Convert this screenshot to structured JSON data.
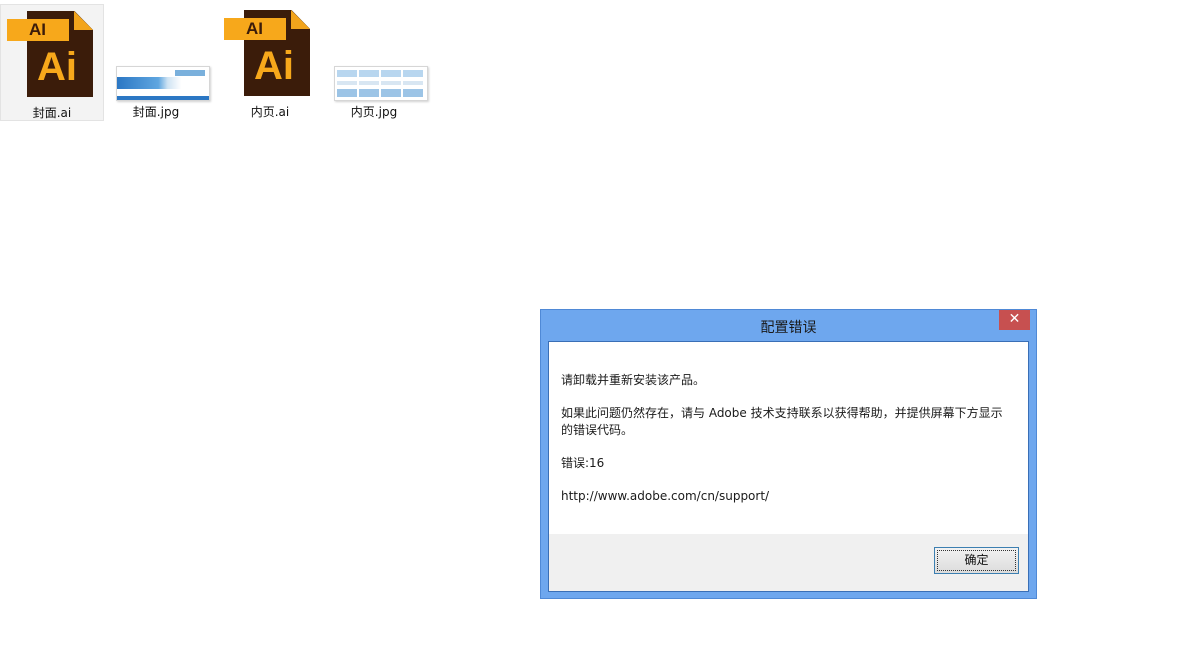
{
  "files": [
    {
      "name": "封面.ai",
      "type": "ai",
      "icon_text": "AI",
      "icon_big": "Ai",
      "selected": true
    },
    {
      "name": "封面.jpg",
      "type": "jpg",
      "selected": false
    },
    {
      "name": "内页.ai",
      "type": "ai",
      "icon_text": "AI",
      "icon_big": "Ai",
      "selected": false
    },
    {
      "name": "内页.jpg",
      "type": "jpg",
      "selected": false
    }
  ],
  "dialog": {
    "title": "配置错误",
    "close_label": "✕",
    "line1": "请卸载并重新安装该产品。",
    "line2": "如果此问题仍然存在，请与 Adobe 技术支持联系以获得帮助，并提供屏幕下方显示的错误代码。",
    "error_code": "错误:16",
    "support_url": "http://www.adobe.com/cn/support/",
    "ok_label": "确定"
  },
  "colors": {
    "ai_brand_orange": "#f7a81b",
    "ai_brand_brown": "#3b1c0a",
    "dialog_frame": "#6ea7ee",
    "close_button": "#c75050"
  }
}
